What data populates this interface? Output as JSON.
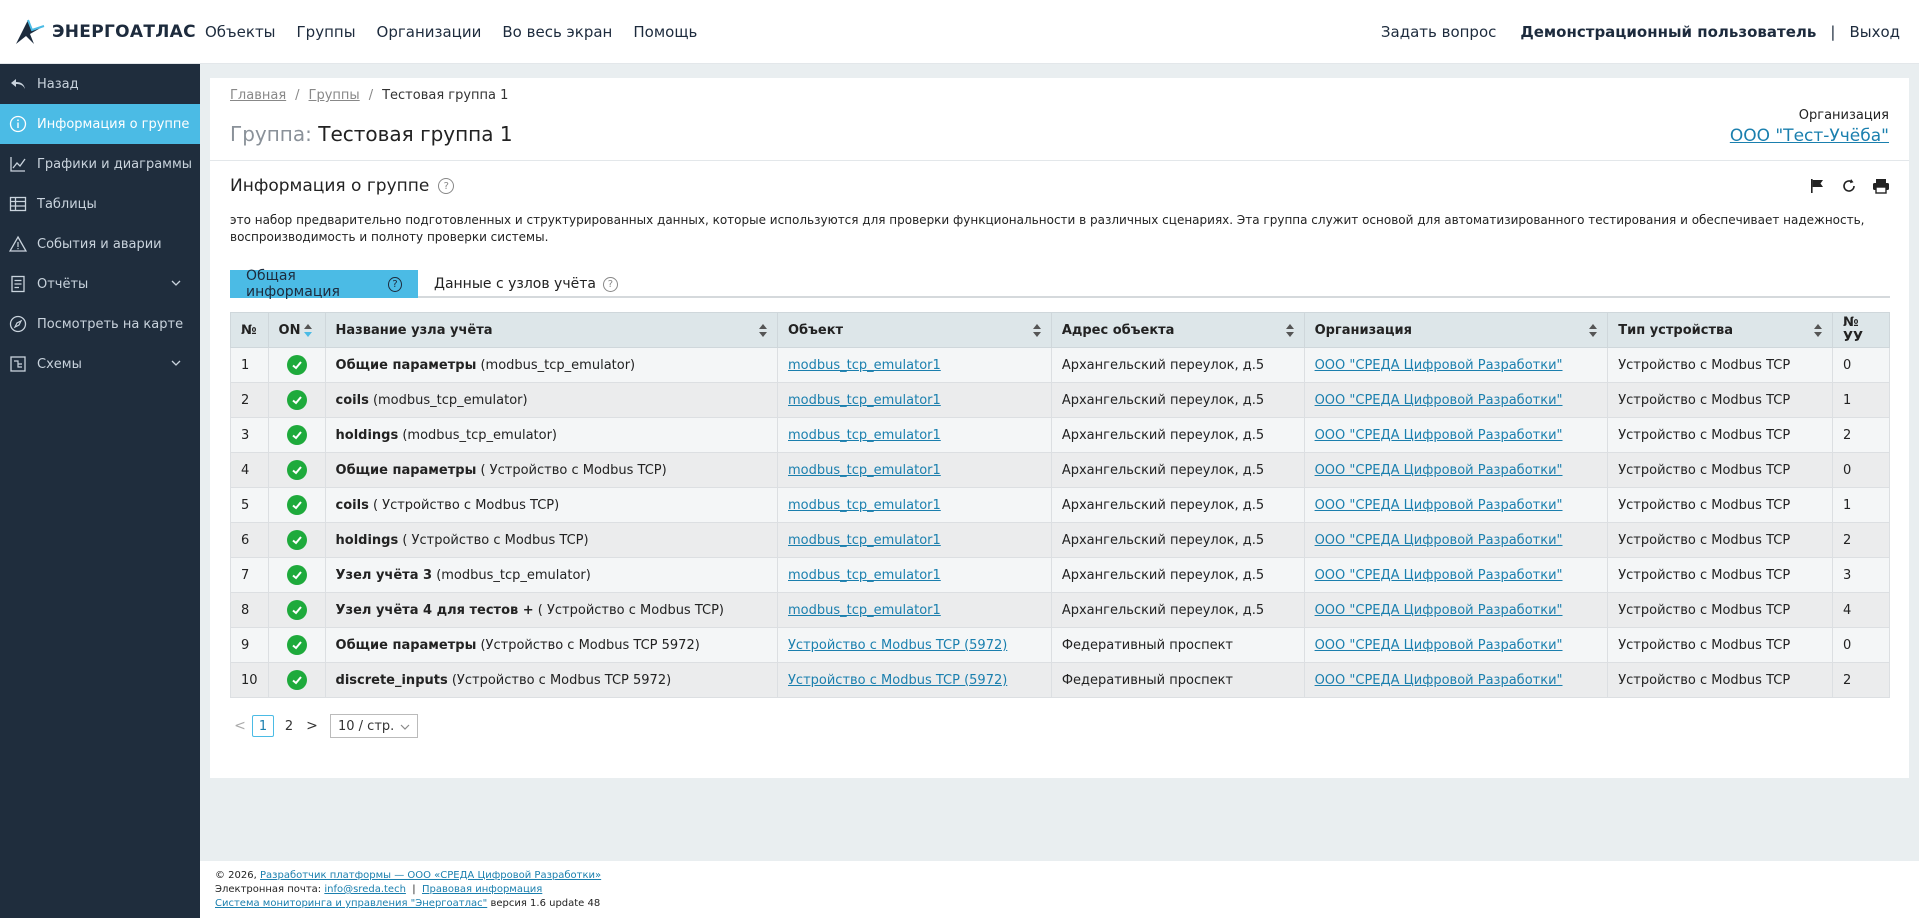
{
  "brand": {
    "name": "ЭНЕРГОАТЛАС",
    "color": "#1d2b3d",
    "accent": "#4bbbe5"
  },
  "topnav": {
    "items": [
      "Объекты",
      "Группы",
      "Организации",
      "Во весь экран",
      "Помощь"
    ],
    "ask": "Задать вопрос",
    "user": "Демонстрационный пользователь",
    "separator": "|",
    "logout": "Выход"
  },
  "sidebar": {
    "items": [
      {
        "label": "Назад",
        "icon": "back-arrow-icon",
        "active": false,
        "has_chevron": false
      },
      {
        "label": "Информация о группе",
        "icon": "info-circle-icon",
        "active": true,
        "has_chevron": false
      },
      {
        "label": "Графики и диаграммы",
        "icon": "line-chart-icon",
        "active": false,
        "has_chevron": false
      },
      {
        "label": "Таблицы",
        "icon": "table-icon",
        "active": false,
        "has_chevron": false
      },
      {
        "label": "События и аварии",
        "icon": "warning-triangle-icon",
        "active": false,
        "has_chevron": false
      },
      {
        "label": "Отчёты",
        "icon": "document-icon",
        "active": false,
        "has_chevron": true
      },
      {
        "label": "Посмотреть на карте",
        "icon": "compass-icon",
        "active": false,
        "has_chevron": false
      },
      {
        "label": "Схемы",
        "icon": "schema-icon",
        "active": false,
        "has_chevron": true
      }
    ]
  },
  "breadcrumb": {
    "home": "Главная",
    "groups": "Группы",
    "current": "Тестовая группа 1",
    "separator": "/"
  },
  "page": {
    "title_prefix": "Группа:",
    "title": "Тестовая группа 1",
    "org_label": "Организация",
    "org_name": "ООО \"Тест-Учёба\""
  },
  "section": {
    "title": "Информация о группе",
    "help": "?",
    "description": "это набор предварительно подготовленных и структурированных данных, которые используются для проверки функциональности в различных сценариях. Эта группа служит основой для автоматизированного тестирования и обеспечивает надежность, воспроизводимость и полноту проверки системы.",
    "tools": [
      "flag-icon",
      "refresh-icon",
      "print-icon"
    ]
  },
  "tabs": [
    {
      "label": "Общая информация",
      "active": true
    },
    {
      "label": "Данные с узлов учёта",
      "active": false
    }
  ],
  "table": {
    "columns": [
      "№",
      "ON",
      "Название узла учёта",
      "Объект",
      "Адрес объекта",
      "Организация",
      "Тип устройства",
      "№ УУ"
    ],
    "rows": [
      {
        "n": "1",
        "name_bold": "Общие параметры",
        "name_rest": " (modbus_tcp_emulator)",
        "object": "modbus_tcp_emulator1",
        "address": "Архангельский переулок, д.5",
        "org": "ООО \"СРЕДА Цифровой Разработки\"",
        "device": "Устройство с Modbus TCP",
        "uu": "0"
      },
      {
        "n": "2",
        "name_bold": "coils",
        "name_rest": " (modbus_tcp_emulator)",
        "object": "modbus_tcp_emulator1",
        "address": "Архангельский переулок, д.5",
        "org": "ООО \"СРЕДА Цифровой Разработки\"",
        "device": "Устройство с Modbus TCP",
        "uu": "1"
      },
      {
        "n": "3",
        "name_bold": "holdings",
        "name_rest": " (modbus_tcp_emulator)",
        "object": "modbus_tcp_emulator1",
        "address": "Архангельский переулок, д.5",
        "org": "ООО \"СРЕДА Цифровой Разработки\"",
        "device": "Устройство с Modbus TCP",
        "uu": "2"
      },
      {
        "n": "4",
        "name_bold": "Общие параметры",
        "name_rest": " ( Устройство с Modbus TCP)",
        "object": "modbus_tcp_emulator1",
        "address": "Архангельский переулок, д.5",
        "org": "ООО \"СРЕДА Цифровой Разработки\"",
        "device": "Устройство с Modbus TCP",
        "uu": "0"
      },
      {
        "n": "5",
        "name_bold": "coils",
        "name_rest": " ( Устройство с Modbus TCP)",
        "object": "modbus_tcp_emulator1",
        "address": "Архангельский переулок, д.5",
        "org": "ООО \"СРЕДА Цифровой Разработки\"",
        "device": "Устройство с Modbus TCP",
        "uu": "1"
      },
      {
        "n": "6",
        "name_bold": "holdings",
        "name_rest": " ( Устройство с Modbus TCP)",
        "object": "modbus_tcp_emulator1",
        "address": "Архангельский переулок, д.5",
        "org": "ООО \"СРЕДА Цифровой Разработки\"",
        "device": "Устройство с Modbus TCP",
        "uu": "2"
      },
      {
        "n": "7",
        "name_bold": "Узел учёта 3",
        "name_rest": " (modbus_tcp_emulator)",
        "object": "modbus_tcp_emulator1",
        "address": "Архангельский переулок, д.5",
        "org": "ООО \"СРЕДА Цифровой Разработки\"",
        "device": "Устройство с Modbus TCP",
        "uu": "3"
      },
      {
        "n": "8",
        "name_bold": "Узел учёта 4 для тестов +",
        "name_rest": " ( Устройство с Modbus TCP)",
        "object": "modbus_tcp_emulator1",
        "address": "Архангельский переулок, д.5",
        "org": "ООО \"СРЕДА Цифровой Разработки\"",
        "device": "Устройство с Modbus TCP",
        "uu": "4"
      },
      {
        "n": "9",
        "name_bold": "Общие параметры",
        "name_rest": " (Устройство с Modbus TCP 5972)",
        "object": "Устройство с Modbus TCP (5972)",
        "address": "Федеративный проспект",
        "org": "ООО \"СРЕДА Цифровой Разработки\"",
        "device": "Устройство с Modbus TCP",
        "uu": "0"
      },
      {
        "n": "10",
        "name_bold": "discrete_inputs",
        "name_rest": " (Устройство с Modbus TCP 5972)",
        "object": "Устройство с Modbus TCP (5972)",
        "address": "Федеративный проспект",
        "org": "ООО \"СРЕДА Цифровой Разработки\"",
        "device": "Устройство с Modbus TCP",
        "uu": "2"
      }
    ]
  },
  "pagination": {
    "prev": "<",
    "pages": [
      "1",
      "2"
    ],
    "current": "1",
    "next": ">",
    "page_size": "10 / стр."
  },
  "footer": {
    "line1_prefix": "© 2026,",
    "line1_link": "Разработчик платформы — ООО «СРЕДА Цифровой Разработки»",
    "line2_prefix": "Электронная почта:",
    "email": "info@sreda.tech",
    "line2_sep": "|",
    "legal": "Правовая информация",
    "system_link": "Система мониторинга и управления \"Энергоатлас\"",
    "version": "версия 1.6 update 48"
  }
}
